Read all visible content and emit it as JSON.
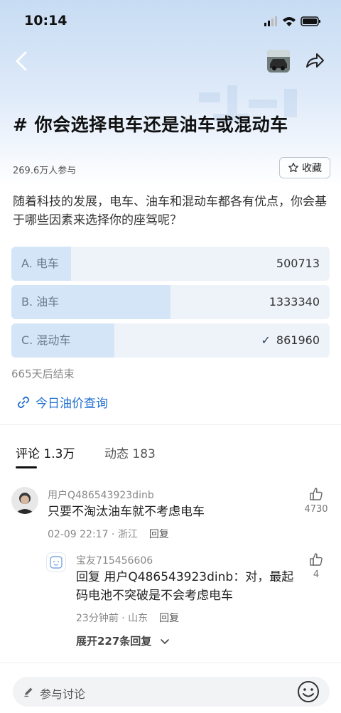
{
  "status_bar": {
    "time": "10:14"
  },
  "topic": {
    "title": "# 你会选择电车还是油车或混动车",
    "participants": "269.6万人参与",
    "favorite_label": "收藏",
    "question": "随着科技的发展，电车、油车和混动车都各有优点，你会基于哪些因素来选择你的座驾呢？"
  },
  "poll": {
    "options": [
      {
        "label": "A. 电车",
        "count": "500713",
        "votes": 500713,
        "selected": false
      },
      {
        "label": "B. 油车",
        "count": "1333340",
        "votes": 1333340,
        "selected": true
      },
      {
        "label": "C. 混动车",
        "count": "861960",
        "votes": 861960,
        "selected": false,
        "checkmark": "✓"
      }
    ],
    "ends_in": "665天后结束"
  },
  "oil_price_link": "今日油价查询",
  "tabs": [
    {
      "label": "评论 1.3万",
      "active": true
    },
    {
      "label": "动态 183",
      "active": false
    }
  ],
  "comments": [
    {
      "user": "用户Q486543923dinb",
      "text": "只要不淘汰油车就不考虑电车",
      "time_location": "02-09 22:17 · 浙江",
      "reply_label": "回复",
      "likes": "4730"
    }
  ],
  "reply": {
    "user": "宝友715456606",
    "text_line1": "回复 用户Q486543923dinb：对，最起",
    "text_line2": "码电池不突破是不会考虑电车",
    "time_location": "23分钟前 · 山东",
    "reply_label": "回复",
    "likes": "4",
    "expand_label": "展开227条回复"
  },
  "input": {
    "placeholder": "参与讨论"
  },
  "colors": {
    "accent": "#1f6fd1",
    "poll_fill": "#d5e5f8",
    "poll_bg": "#eef3fa"
  },
  "icons": [
    "back-icon",
    "share-icon",
    "star-icon",
    "link-icon",
    "thumb-up-icon",
    "chevron-down-icon",
    "pen-icon",
    "emoji-icon"
  ]
}
